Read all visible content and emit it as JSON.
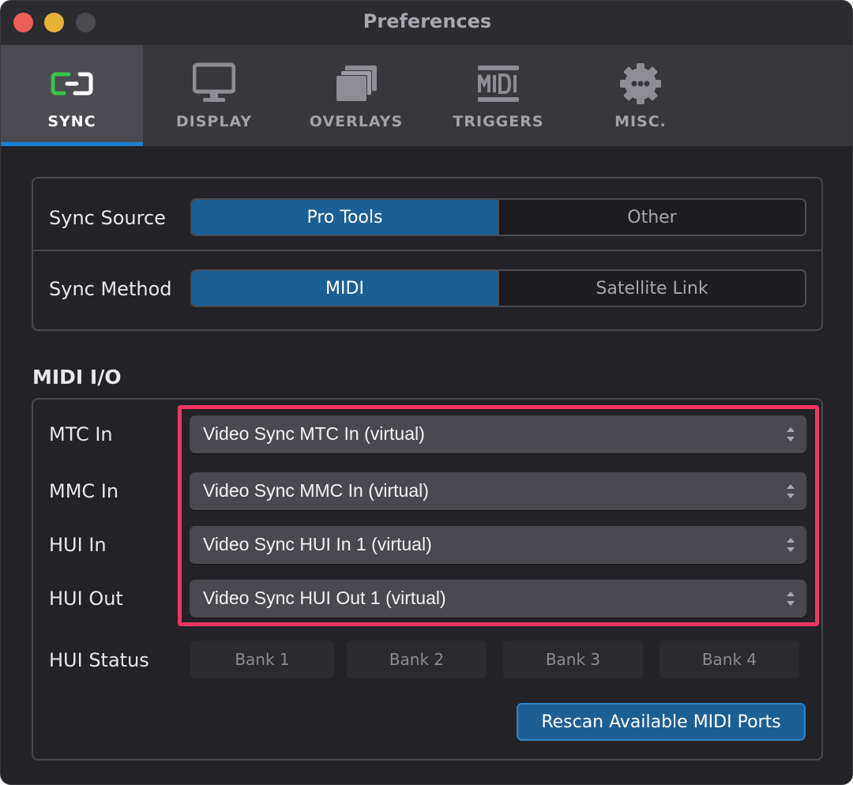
{
  "window": {
    "title": "Preferences"
  },
  "tabs": [
    {
      "label": "SYNC",
      "icon": "sync-link-icon",
      "active": true
    },
    {
      "label": "DISPLAY",
      "icon": "monitor-icon",
      "active": false
    },
    {
      "label": "OVERLAYS",
      "icon": "layers-icon",
      "active": false
    },
    {
      "label": "TRIGGERS",
      "icon": "midi-icon",
      "active": false
    },
    {
      "label": "MISC.",
      "icon": "gear-icon",
      "active": false
    }
  ],
  "sync": {
    "source": {
      "label": "Sync Source",
      "options": [
        "Pro Tools",
        "Other"
      ],
      "selected": "Pro Tools"
    },
    "method": {
      "label": "Sync Method",
      "options": [
        "MIDI",
        "Satellite Link"
      ],
      "selected": "MIDI"
    }
  },
  "midi_io": {
    "title": "MIDI I/O",
    "ports": [
      {
        "label": "MTC In",
        "value": "Video Sync MTC In (virtual)"
      },
      {
        "label": "MMC In",
        "value": "Video Sync MMC In (virtual)"
      },
      {
        "label": "HUI In",
        "value": "Video Sync HUI In 1 (virtual)"
      },
      {
        "label": "HUI Out",
        "value": "Video Sync HUI Out 1 (virtual)"
      }
    ],
    "hui_status": {
      "label": "HUI Status",
      "banks": [
        "Bank 1",
        "Bank 2",
        "Bank 3",
        "Bank 4"
      ]
    },
    "rescan_label": "Rescan Available MIDI Ports"
  },
  "colors": {
    "accent": "#1c5f94",
    "tab_underline": "#1f7fd0",
    "highlight": "#f23566",
    "sync_icon_green": "#39c24a"
  }
}
